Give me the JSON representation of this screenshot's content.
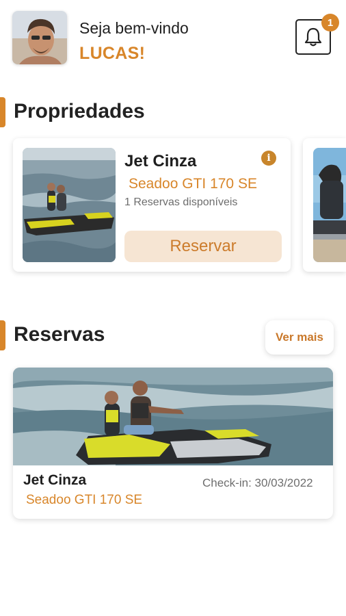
{
  "header": {
    "greeting": "Seja bem-vindo",
    "user_name": "LUCAS!",
    "notification_count": "1"
  },
  "properties_section": {
    "title": "Propriedades",
    "card": {
      "name": "Jet Cinza",
      "model": "Seadoo GTI 170 SE",
      "availability": "1 Reservas disponíveis",
      "info_label": "i",
      "button_label": "Reservar"
    }
  },
  "reservations_section": {
    "title": "Reservas",
    "see_more_label": "Ver mais",
    "card": {
      "name": "Jet Cinza",
      "model": "Seadoo GTI 170 SE",
      "checkin": "Check-in: 30/03/2022"
    }
  },
  "colors": {
    "accent": "#d8862a",
    "button_bg": "#f6e5d3",
    "text_dark": "#1e1e1e",
    "text_muted": "#6d6d6d"
  },
  "icons": [
    "bell-icon",
    "info-icon"
  ]
}
